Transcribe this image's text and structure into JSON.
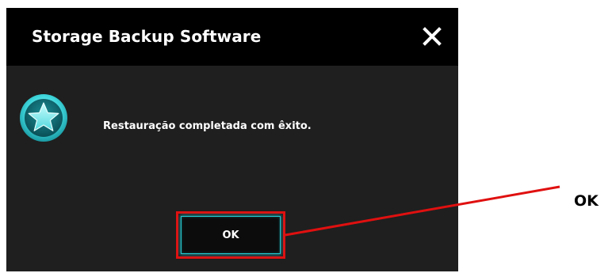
{
  "dialog": {
    "title": "Storage Backup Software",
    "close_icon": "close-icon",
    "message_icon": "star-icon",
    "message": "Restauração completada com êxito.",
    "ok_label": "OK"
  },
  "annotation": {
    "label": "OK",
    "color": "#e01010"
  },
  "colors": {
    "titlebar": "#000000",
    "dialog_body": "#1f1f1f",
    "accent": "#22c7cf",
    "highlight": "#e01010"
  }
}
